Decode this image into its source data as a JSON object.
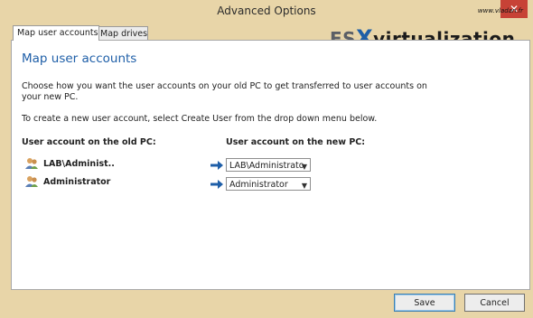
{
  "window": {
    "title": "Advanced Options",
    "close_glyph": "✕"
  },
  "tabs": [
    {
      "label": "Map user accounts",
      "active": true
    },
    {
      "label": "Map drives",
      "active": false
    }
  ],
  "panel": {
    "heading": "Map user accounts",
    "description_line1": "Choose how you want the user accounts on your old PC to get transferred to user accounts on",
    "description_line2": "your new PC.",
    "instruction": "To create a new user account, select Create User from the drop down menu below.",
    "col_old": "User account on the old PC:",
    "col_new": "User account on the new PC:",
    "rows": [
      {
        "old_user": "LAB\\Administ..",
        "new_user": "LAB\\Administrato"
      },
      {
        "old_user": "Administrator",
        "new_user": "Administrator"
      }
    ]
  },
  "watermark": {
    "url": "www.vladan.fr",
    "brand_es": "ES",
    "brand_x": "X",
    "brand_rest": "virtualization"
  },
  "footer": {
    "save_label": "Save",
    "cancel_label": "Cancel"
  },
  "colors": {
    "accent_blue": "#1f5fa8",
    "titlebar_bg": "#e8d5a8",
    "close_red": "#c74236"
  }
}
